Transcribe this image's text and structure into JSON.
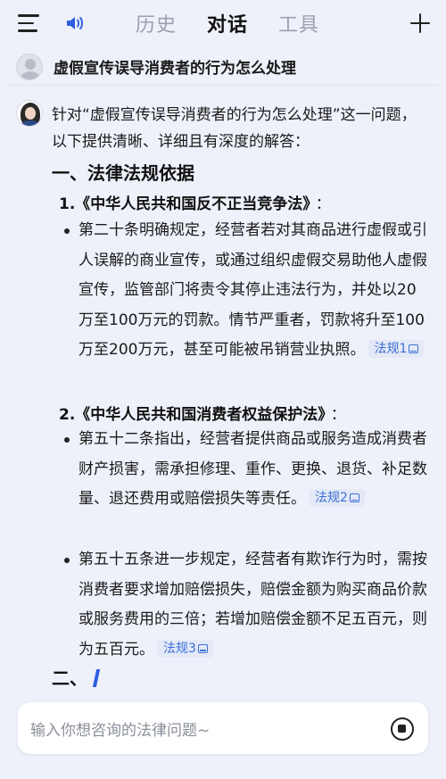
{
  "header": {
    "tabs": [
      {
        "label": "历史",
        "active": false
      },
      {
        "label": "对话",
        "active": true
      },
      {
        "label": "工具",
        "active": false
      }
    ],
    "icons": {
      "menu": "menu-icon",
      "speaker": "speaker-icon",
      "new_chat": "plus-icon"
    }
  },
  "question": {
    "text": "虚假宣传误导消费者的行为怎么处理"
  },
  "answer": {
    "intro": "针对“虚假宣传误导消费者的行为怎么处理”这一问题，以下提供清晰、详细且有深度的解答：",
    "section1_title": "一、法律法规依据",
    "laws": [
      {
        "title": "1.《中华人民共和国反不正当竞争法》",
        "colon": "：",
        "items": [
          {
            "text": "第二十条明确规定，经营者若对其商品进行虚假或引人误解的商业宣传，或通过组织虚假交易助他人虚假宣传，监管部门将责令其停止违法行为，并处以20万至100万元的罚款。情节严重者，罚款将升至100万至200万元，甚至可能被吊销营业执照。",
            "cite": "法规1"
          }
        ]
      },
      {
        "title": "2.《中华人民共和国消费者权益保护法》",
        "colon": "：",
        "items": [
          {
            "text": "第五十二条指出，经营者提供商品或服务造成消费者财产损害，需承担修理、重作、更换、退货、补足数量、退还费用或赔偿损失等责任。",
            "cite": "法规2"
          },
          {
            "text": "第五十五条进一步规定，经营者有欺诈行为时，需按消费者要求增加赔偿损失，赔偿金额为购买商品价款或服务费用的三倍；若增加赔偿金额不足五百元，则为五百元。",
            "cite": "法规3"
          }
        ]
      }
    ],
    "section2_title": "二、"
  },
  "input": {
    "placeholder": "输入你想咨询的法律问题~"
  },
  "colors": {
    "accent": "#3b6fd6",
    "background": "#eef1fa"
  }
}
